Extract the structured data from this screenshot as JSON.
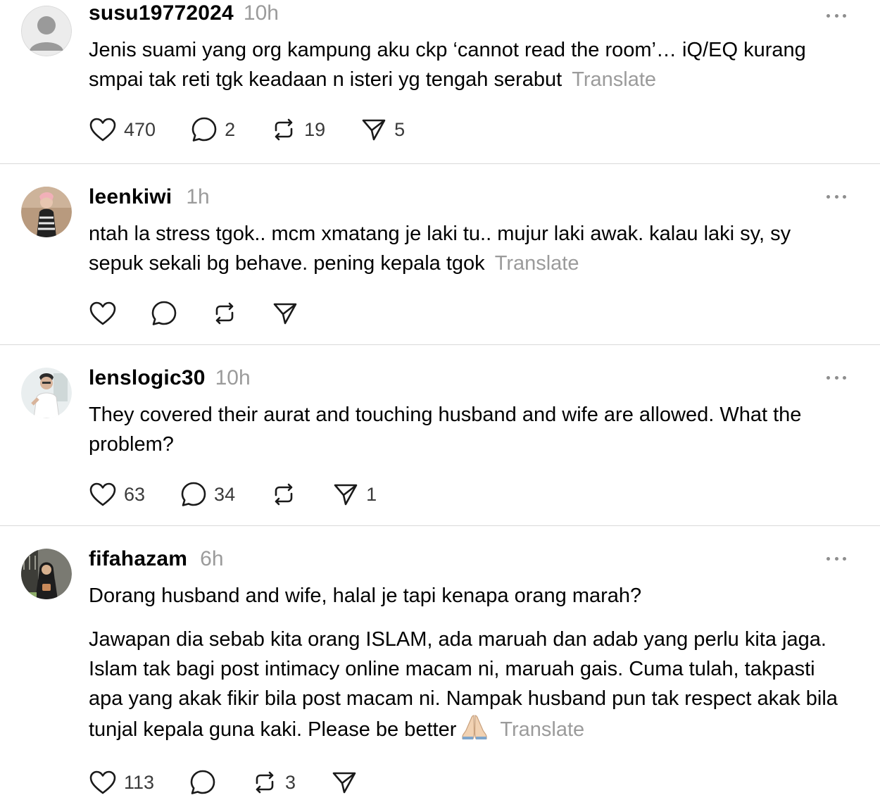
{
  "posts": [
    {
      "username": "susu19772024",
      "time": "10h",
      "avatar": "default-user-avatar",
      "paragraphs": [
        "Jenis suami yang org kampung aku ckp ‘cannot read the room’… iQ/EQ kurang smpai tak reti tgk keadaan n isteri yg tengah serabut"
      ],
      "translate": "Translate",
      "likes": "470",
      "replies": "2",
      "reposts": "19",
      "shares": "5"
    },
    {
      "username": "leenkiwi",
      "time": "1h",
      "avatar": "photo-avatar",
      "paragraphs": [
        "ntah la stress tgok.. mcm xmatang je laki tu.. mujur laki awak. kalau laki sy, sy sepuk sekali bg behave. pening kepala tgok"
      ],
      "translate": "Translate",
      "likes": "",
      "replies": "",
      "reposts": "",
      "shares": ""
    },
    {
      "username": "lenslogic30",
      "time": "10h",
      "avatar": "photo-avatar",
      "paragraphs": [
        "They covered their aurat and touching husband and wife are allowed. What the problem?"
      ],
      "translate": "",
      "likes": "63",
      "replies": "34",
      "reposts": "",
      "shares": "1"
    },
    {
      "username": "fifahazam",
      "time": "6h",
      "avatar": "photo-avatar",
      "paragraphs": [
        "Dorang husband and wife, halal je tapi kenapa orang marah?",
        "Jawapan dia sebab kita orang ISLAM, ada maruah dan adab yang perlu kita jaga. Islam tak bagi post intimacy online macam ni, maruah gais. Cuma tulah, takpasti apa yang akak fikir bila post macam ni. Nampak husband pun tak respect akak bila tunjal kepala guna kaki. Please be better"
      ],
      "emoji": "🙏🏼",
      "translate": "Translate",
      "likes": "113",
      "replies": "",
      "reposts": "3",
      "shares": ""
    }
  ],
  "colors": {
    "muted": "#9b9b9b",
    "divider": "#d9d9d9",
    "icon": "#1a1a1a"
  }
}
